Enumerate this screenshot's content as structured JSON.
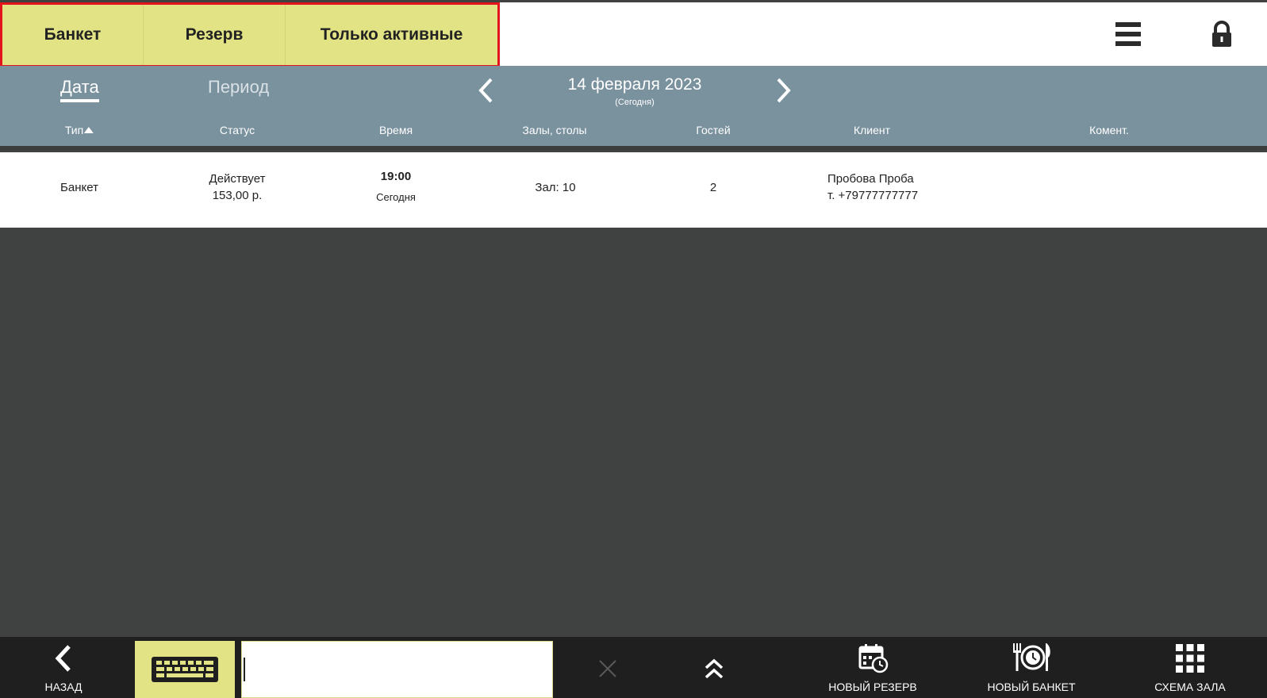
{
  "filters": {
    "banquet": "Банкет",
    "reserve": "Резерв",
    "only_active": "Только активные"
  },
  "header_icons": {
    "menu": "hamburger-menu-icon",
    "lock": "lock-icon"
  },
  "date_nav": {
    "tab_date": "Дата",
    "tab_period": "Период",
    "date": "14 февраля 2023",
    "date_note": "(Сегодня)"
  },
  "columns": {
    "type": "Тип",
    "status": "Статус",
    "time": "Время",
    "halls": "Залы, столы",
    "guests": "Гостей",
    "client": "Клиент",
    "comment": "Комент."
  },
  "rows": [
    {
      "type": "Банкет",
      "status": "Действует",
      "amount": "153,00 р.",
      "time": "19:00",
      "day": "Сегодня",
      "halls": "Зал: 10",
      "guests": "2",
      "client_name": "Пробова Проба",
      "client_phone": "т. +79777777777",
      "comment": ""
    }
  ],
  "bottom": {
    "back": "НАЗАД",
    "search_value": "",
    "new_reserve": "НОВЫЙ РЕЗЕРВ",
    "new_banquet": "НОВЫЙ БАНКЕТ",
    "hall_scheme": "СХЕМА ЗАЛА"
  },
  "colors": {
    "accent": "#e1e385",
    "header_bar": "#7a919e",
    "background": "#404241",
    "bottom_bar": "#1f1f1f",
    "highlight_border": "#e3141b"
  }
}
